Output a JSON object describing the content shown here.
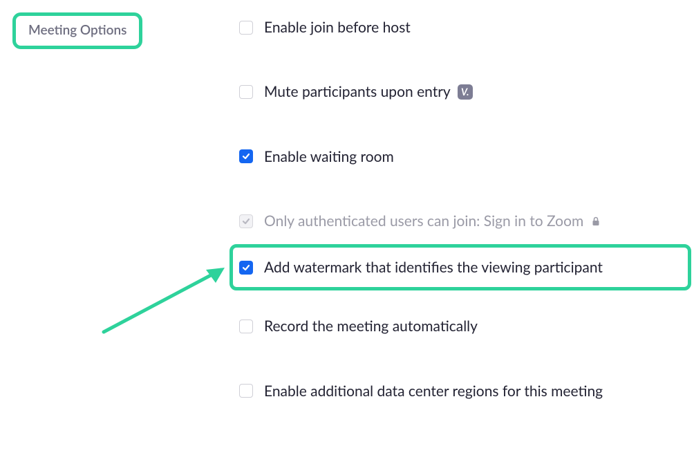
{
  "section": {
    "title": "Meeting Options"
  },
  "options": {
    "join_before_host": {
      "label": "Enable join before host"
    },
    "mute_on_entry": {
      "label": "Mute participants upon entry",
      "badge": "V."
    },
    "waiting_room": {
      "label": "Enable waiting room"
    },
    "auth_users": {
      "label": "Only authenticated users can join: Sign in to Zoom"
    },
    "watermark": {
      "label": "Add watermark that identifies the viewing participant"
    },
    "auto_record": {
      "label": "Record the meeting automatically"
    },
    "data_center": {
      "label": "Enable additional data center regions for this meeting"
    }
  },
  "annotation": {
    "highlight_color": "#2ed29b"
  }
}
